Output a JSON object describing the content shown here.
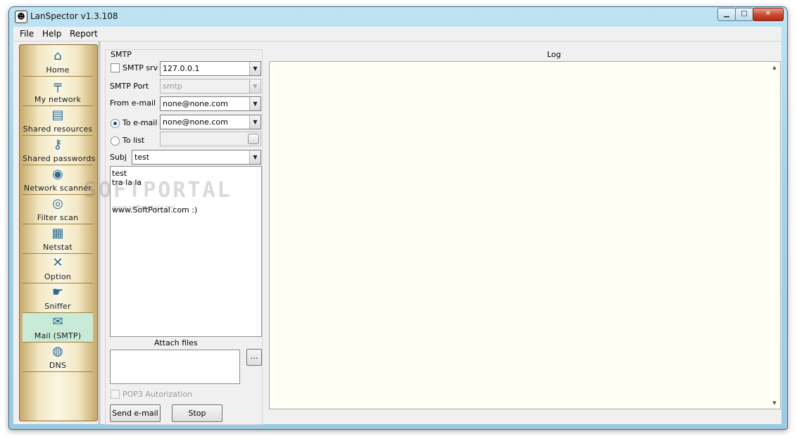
{
  "window": {
    "title": "LanSpector v1.3.108",
    "app_icon": "lanspector-app-icon",
    "controls": {
      "minimize": "minimize-icon",
      "maximize": "maximize-icon",
      "close": "close-icon"
    }
  },
  "menu": [
    "File",
    "Help",
    "Report"
  ],
  "sidebar": {
    "items": [
      {
        "label": "Home",
        "icon": "home-icon",
        "selected": false
      },
      {
        "label": "My network",
        "icon": "network-icon",
        "selected": false
      },
      {
        "label": "Shared resources",
        "icon": "shared-resources-icon",
        "selected": false
      },
      {
        "label": "Shared passwords",
        "icon": "keys-icon",
        "selected": false
      },
      {
        "label": "Network scanner",
        "icon": "scanner-icon",
        "selected": false
      },
      {
        "label": "Filter scan",
        "icon": "filter-icon",
        "selected": false
      },
      {
        "label": "Netstat",
        "icon": "netstat-icon",
        "selected": false
      },
      {
        "label": "Option",
        "icon": "tools-icon",
        "selected": false
      },
      {
        "label": "Sniffer",
        "icon": "sniffer-icon",
        "selected": false
      },
      {
        "label": "Mail (SMTP)",
        "icon": "mail-icon",
        "selected": true
      },
      {
        "label": "DNS",
        "icon": "globe-icon",
        "selected": false
      }
    ]
  },
  "smtp": {
    "group_title": "SMTP",
    "smtp_srv": {
      "label": "SMTP srv",
      "checked": false,
      "value": "127.0.0.1",
      "disabled": true
    },
    "smtp_port": {
      "label": "SMTP Port",
      "placeholder": "smtp",
      "disabled": true
    },
    "from_email": {
      "label": "From e-mail",
      "value": "none@none.com"
    },
    "to_email": {
      "label": "To e-mail",
      "selected": true,
      "value": "none@none.com"
    },
    "to_list": {
      "label": "To list",
      "selected": false,
      "value": ""
    },
    "subject": {
      "label": "Subj",
      "value": "test"
    },
    "body_lines": [
      "test",
      "tra la la",
      "",
      "",
      "www.SoftPortal.com :)"
    ],
    "attach_title": "Attach files",
    "attach_browse": "...",
    "pop3": {
      "label": "POP3 Autorization",
      "checked": false,
      "disabled": true
    },
    "send_button": "Send e-mail",
    "stop_button": "Stop"
  },
  "log": {
    "title": "Log",
    "content": ""
  },
  "watermark": {
    "text": "SOFTPORTAL",
    "sub": "www.softportal.com"
  }
}
